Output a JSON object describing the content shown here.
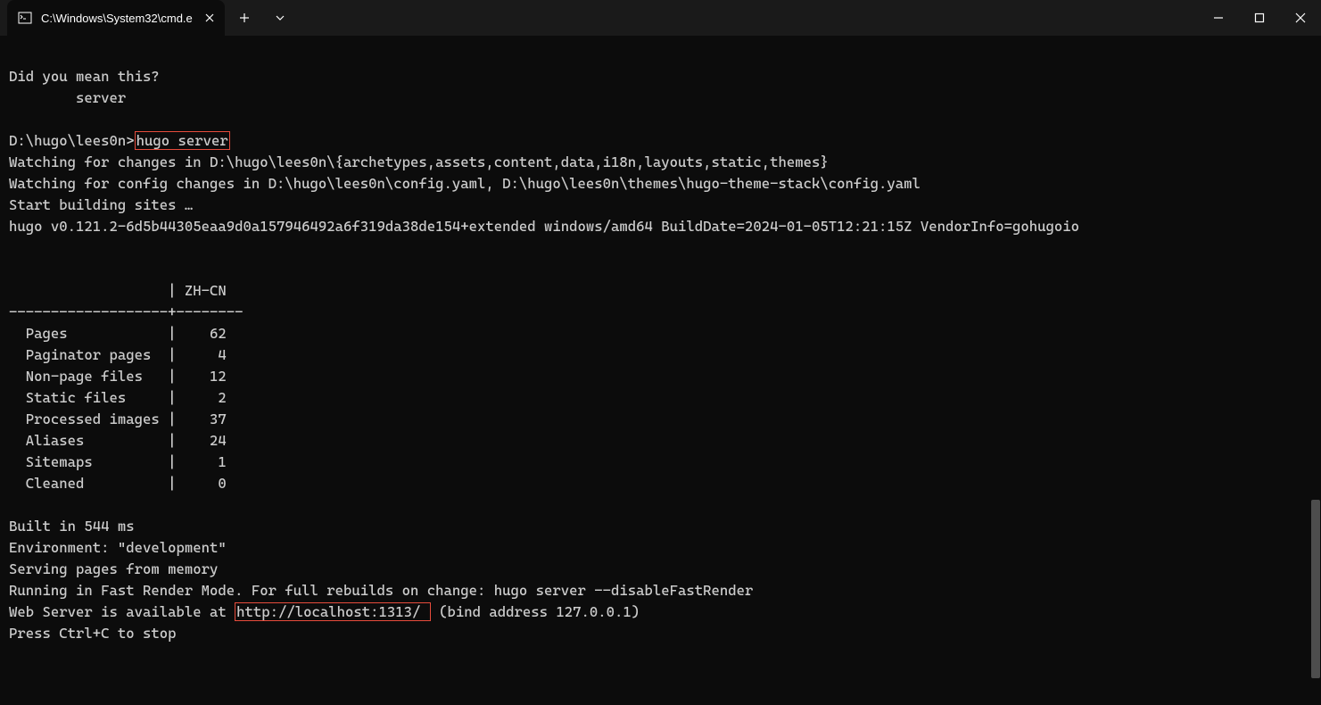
{
  "tab": {
    "title": "C:\\Windows\\System32\\cmd.e"
  },
  "terminal": {
    "line1": "Did you mean this?",
    "line2": "        server",
    "prompt1_prefix": "D:\\hugo\\lees0n>",
    "prompt1_cmd": "hugo server",
    "line4": "Watching for changes in D:\\hugo\\lees0n\\{archetypes,assets,content,data,i18n,layouts,static,themes}",
    "line5": "Watching for config changes in D:\\hugo\\lees0n\\config.yaml, D:\\hugo\\lees0n\\themes\\hugo-theme-stack\\config.yaml",
    "line6": "Start building sites …",
    "line7": "hugo v0.121.2-6d5b44305eaa9d0a157946492a6f319da38de154+extended windows/amd64 BuildDate=2024-01-05T12:21:15Z VendorInfo=gohugoio",
    "tableHeader": "                   | ZH-CN  ",
    "tableDivider": "-------------------+--------",
    "tableRow1": "  Pages            |    62  ",
    "tableRow2": "  Paginator pages  |     4  ",
    "tableRow3": "  Non-page files   |    12  ",
    "tableRow4": "  Static files     |     2  ",
    "tableRow5": "  Processed images |    37  ",
    "tableRow6": "  Aliases          |    24  ",
    "tableRow7": "  Sitemaps         |     1  ",
    "tableRow8": "  Cleaned          |     0  ",
    "line_built": "Built in 544 ms",
    "line_env": "Environment: \"development\"",
    "line_serving": "Serving pages from memory",
    "line_fastrender": "Running in Fast Render Mode. For full rebuilds on change: hugo server --disableFastRender",
    "line_webserver_prefix": "Web Server is available at ",
    "line_webserver_url": "http://localhost:1313/ ",
    "line_webserver_suffix": "(bind address 127.0.0.1)",
    "line_stop": "Press Ctrl+C to stop"
  }
}
